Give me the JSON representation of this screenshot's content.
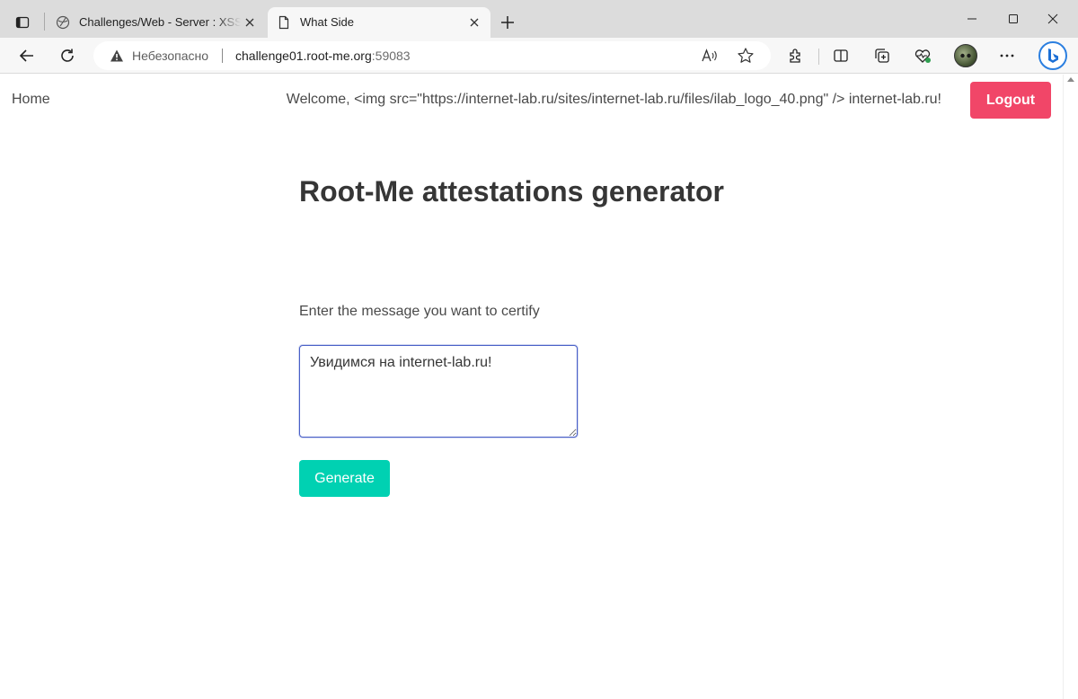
{
  "browser": {
    "tabs": [
      {
        "title": "Challenges/Web - Server : XSS - Stored",
        "icon": "globe-icon",
        "active": false
      },
      {
        "title": "What Side",
        "icon": "page-icon",
        "active": true
      }
    ],
    "address": {
      "security_label": "Небезопасно",
      "host": "challenge01.root-me.org",
      "port": ":59083"
    }
  },
  "nav": {
    "home_label": "Home",
    "welcome_text": "Welcome, <img src=\"https://internet-lab.ru/sites/internet-lab.ru/files/ilab_logo_40.png\" /> internet-lab.ru!",
    "logout_label": "Logout"
  },
  "main": {
    "title": "Root-Me attestations generator",
    "prompt_label": "Enter the message you want to certify",
    "message_value": "Увидимся на internet-lab.ru!",
    "generate_label": "Generate"
  },
  "colors": {
    "logout": "#f14668",
    "generate": "#00d1b2",
    "focus_border": "#485fc7"
  }
}
